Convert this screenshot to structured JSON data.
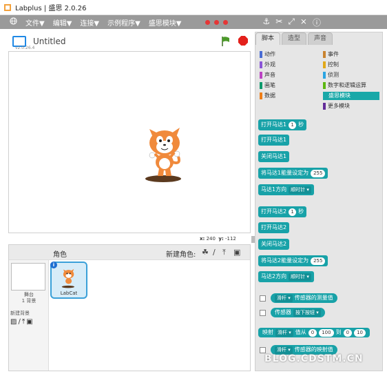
{
  "window": {
    "title": "Labplus | 盛思 2.0.26"
  },
  "menu": {
    "items": [
      "文件▼",
      "编辑▼",
      "连接▼",
      "示例程序▼",
      "盛思模块▼"
    ],
    "icons": [
      "globe-icon",
      "stamp-icon",
      "expand-icon",
      "shrink-icon",
      "help-icon"
    ]
  },
  "stage": {
    "title": "Untitled",
    "version": "v2.0.26.4",
    "x_label": "x:",
    "x_value": "240",
    "y_label": "y:",
    "y_value": "-112"
  },
  "sprites": {
    "header_label": "角色",
    "new_sprite_label": "新建角色:",
    "stage_label": "舞台",
    "stage_sub": "1 背景",
    "new_backdrop_label": "新建背景",
    "sprite_name": "LabCat",
    "info": "i"
  },
  "tabs": [
    "脚本",
    "造型",
    "声音"
  ],
  "categories": [
    {
      "label": "动作",
      "color": "#4a6cd4"
    },
    {
      "label": "外观",
      "color": "#8a55d7"
    },
    {
      "label": "声音",
      "color": "#bb42c3"
    },
    {
      "label": "画笔",
      "color": "#0e9a6c"
    },
    {
      "label": "数据",
      "color": "#ee7d16"
    },
    {
      "label": "事件",
      "color": "#c88330"
    },
    {
      "label": "控制",
      "color": "#e1a91a"
    },
    {
      "label": "侦测",
      "color": "#2ca5e2"
    },
    {
      "label": "数字和逻辑运算",
      "color": "#5cb712"
    },
    {
      "label": "盛思模块",
      "color": "#19a8a8"
    },
    {
      "label": "更多模块",
      "color": "#632d99"
    }
  ],
  "blocks": {
    "b1_a": "打开马达1",
    "b1_v": "1",
    "b1_b": "秒",
    "b2": "打开马达1",
    "b3": "关闭马达1",
    "b4_a": "将马达1能量设定为",
    "b4_v": "255",
    "b5_a": "马达1方向",
    "b5_dd": "顺时针",
    "b6_a": "打开马达2",
    "b6_v": "1",
    "b6_b": "秒",
    "b7": "打开马达2",
    "b8": "关闭马达2",
    "b9_a": "将马达2能量设定为",
    "b9_v": "255",
    "b10_a": "马达2方向",
    "b10_dd": "顺时针",
    "r1_dd": "滑杆",
    "r1_t": "传感器的测量值",
    "r2_a": "传感器",
    "r2_dd": "按下按钮",
    "m_a": "映射",
    "m_dd": "滑杆",
    "m_t1": "值从",
    "m_v1": "0",
    "m_v2": "100",
    "m_t2": "到",
    "m_v3": "0",
    "m_v4": "10",
    "r3_dd": "滑杆",
    "r3_t": "传感器的映射值"
  },
  "watermark": "BLOG.CDSTM.CN",
  "colors": {
    "accent": "#18a2a8",
    "menubar": "#9a9a9a",
    "stop": "#e3201b",
    "flag": "#4c9a2a"
  }
}
